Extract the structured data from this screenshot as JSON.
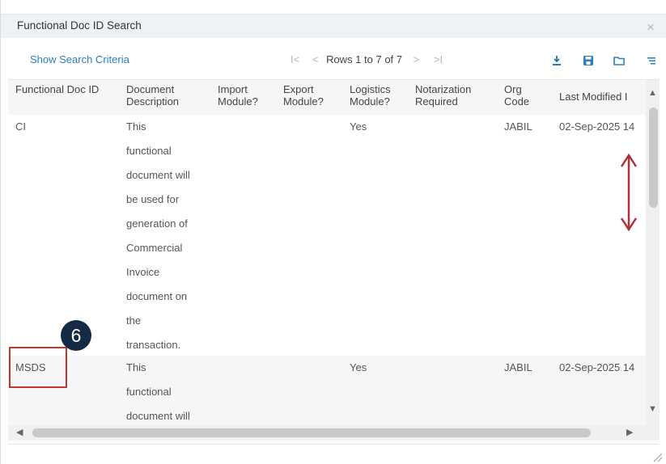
{
  "dialog": {
    "title": "Functional Doc ID Search",
    "close_glyph": "×"
  },
  "toolbar": {
    "show_criteria": "Show Search Criteria",
    "pager": {
      "first_glyph": "I<",
      "prev_glyph": "<",
      "rows_label": "Rows 1 to 7 of 7",
      "next_glyph": ">",
      "last_glyph": ">I"
    },
    "icons": [
      "download-icon",
      "save-icon",
      "folder-icon",
      "menu-icon"
    ]
  },
  "grid": {
    "columns": [
      "Functional Doc ID",
      "Document Description",
      "Import Module?",
      "Export Module?",
      "Logistics Module?",
      "Notarization Required",
      "Org Code",
      "Last Modified I"
    ],
    "rows": [
      {
        "functional_doc_id": "CI",
        "description_lines": [
          "This",
          "functional",
          "document will",
          "be used for",
          "generation of",
          "Commercial",
          "Invoice",
          "document on",
          "the",
          "transaction."
        ],
        "import_module": "",
        "export_module": "",
        "logistics_module": "Yes",
        "notarization_required": "",
        "org_code": "JABIL",
        "last_modified": "02-Sep-2025 14"
      },
      {
        "functional_doc_id": "MSDS",
        "description_lines": [
          "This",
          "functional",
          "document will"
        ],
        "import_module": "",
        "export_module": "",
        "logistics_module": "Yes",
        "notarization_required": "",
        "org_code": "JABIL",
        "last_modified": "02-Sep-2025 14"
      }
    ]
  },
  "callout": {
    "number": "6"
  },
  "colors": {
    "accent_blue": "#2a7fc4",
    "callout_navy": "#152b45",
    "highlight_red": "#c0392b",
    "arrow_red": "#b03038"
  }
}
